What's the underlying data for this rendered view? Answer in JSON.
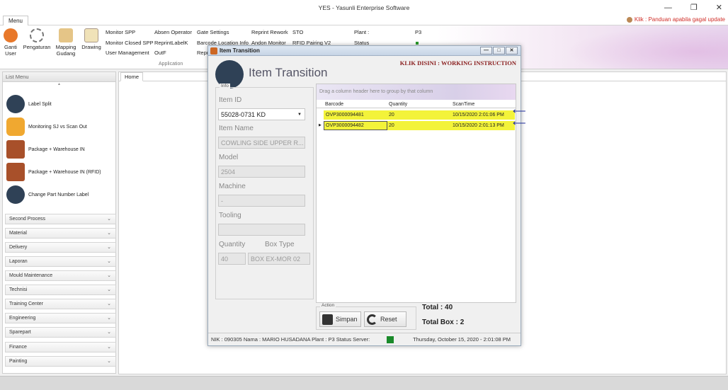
{
  "window": {
    "title": "YES - Yasunli Enterprise Software"
  },
  "menu": {
    "tab_label": "Menu",
    "help_link": "Klik : Panduan apabila gagal update"
  },
  "ribbon": {
    "buttons": [
      {
        "label": "Ganti User"
      },
      {
        "label": "Pengaturan"
      },
      {
        "label": "Mapping Gudang"
      },
      {
        "label": "Drawing"
      }
    ],
    "col1": [
      "Monitor SPP",
      "Monitor Closed SPP",
      "User Management"
    ],
    "col2": [
      "Absen Operator",
      "ReprintLabelK",
      "OutF"
    ],
    "col3": [
      "Gate Settings",
      "Barcode Location Info",
      "Repr"
    ],
    "col4": [
      "Reprint Rework",
      "Andon Monitor"
    ],
    "col5": [
      "STO",
      "RFID Pairing V2"
    ],
    "plant_label": "Plant :",
    "plant_value": "P3",
    "status_label": "Status",
    "group_label": "Application"
  },
  "left_menu": {
    "header": "List Menu",
    "items": [
      {
        "label": "Label Split"
      },
      {
        "label": "Monitoring SJ vs Scan Out"
      },
      {
        "label": "Package + Warehouse IN"
      },
      {
        "label": "Package + Warehouse IN (RFID)"
      },
      {
        "label": "Change Part Number Label"
      }
    ],
    "sections": [
      "Second Process",
      "Material",
      "Delivery",
      "Laporan",
      "Mould Maintenance",
      "Technisi",
      "Training Center",
      "Engineering",
      "Sparepart",
      "Finance",
      "Painting"
    ]
  },
  "home_tab": "Home",
  "dialog": {
    "title": "Item Transition",
    "klik": "KLIK DISINI : WORKING INSTRUCTION",
    "heading": "Item Transition",
    "info_legend": "Info",
    "item_id_label": "Item ID",
    "item_id_value": "55028-0731 KD",
    "item_name_label": "Item Name",
    "item_name_value": "COWLING SIDE UPPER R...",
    "model_label": "Model",
    "model_value": "2504",
    "machine_label": "Machine",
    "machine_value": "-",
    "tooling_label": "Tooling",
    "tooling_value": "",
    "quantity_label": "Quantity",
    "quantity_value": "40",
    "boxtype_label": "Box Type",
    "boxtype_value": "BOX EX-MOR 02",
    "grid": {
      "group_hint": "Drag a column header here to group by that column",
      "headers": [
        "Barcode",
        "Quantity",
        "ScanTime"
      ],
      "rows": [
        {
          "barcode": "OVP3000094481",
          "quantity": "20",
          "scantime": "10/15/2020 2:01:06 PM"
        },
        {
          "barcode": "OVP3000094482",
          "quantity": "20",
          "scantime": "10/15/2020 2:01:13 PM"
        }
      ]
    },
    "action_legend": "Action",
    "simpan": "Simpan",
    "reset": "Reset",
    "total": "Total : 40",
    "total_box": "Total Box : 2",
    "status": {
      "left": "NIK :  090305  Nama :  MARIO HUSADANA  Plant :  P3  Status Server:",
      "datetime": "Thursday, October 15, 2020 - 2:01:08 PM"
    }
  }
}
